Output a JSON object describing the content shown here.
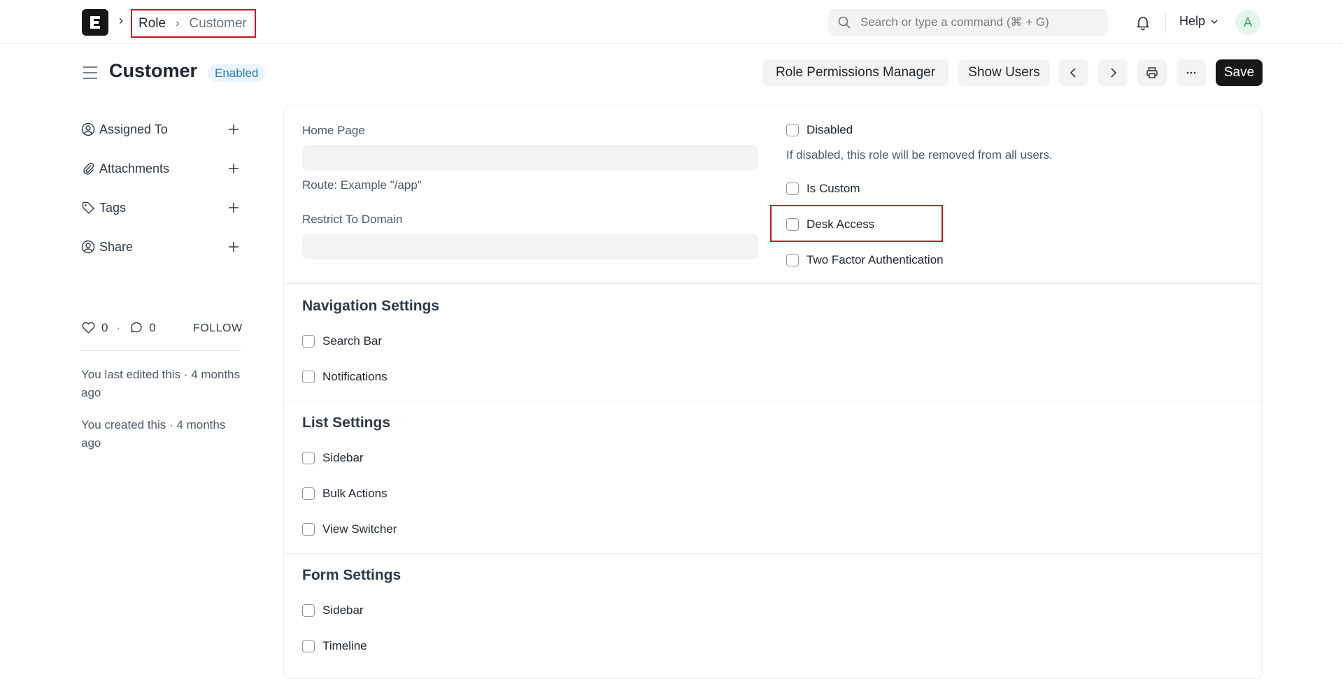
{
  "navbar": {
    "breadcrumb": [
      "Role",
      "Customer"
    ],
    "search_placeholder": "Search or type a command (⌘ + G)",
    "help_label": "Help",
    "avatar_initial": "A"
  },
  "page": {
    "title": "Customer",
    "status": "Enabled",
    "buttons": {
      "role_permissions": "Role Permissions Manager",
      "show_users": "Show Users",
      "save": "Save"
    }
  },
  "sidebar": {
    "items": [
      {
        "label": "Assigned To",
        "icon": "assign-icon"
      },
      {
        "label": "Attachments",
        "icon": "paperclip-icon"
      },
      {
        "label": "Tags",
        "icon": "tag-icon"
      },
      {
        "label": "Share",
        "icon": "share-icon"
      }
    ],
    "likes": "0",
    "comments": "0",
    "follow": "FOLLOW",
    "last_edited": "You last edited this · 4 months ago",
    "created": "You created this · 4 months ago"
  },
  "form": {
    "home_page_label": "Home Page",
    "home_page_value": "",
    "route_help": "Route: Example \"/app\"",
    "restrict_domain_label": "Restrict To Domain",
    "restrict_domain_value": "",
    "disabled_label": "Disabled",
    "disabled_help": "If disabled, this role will be removed from all users.",
    "is_custom_label": "Is Custom",
    "desk_access_label": "Desk Access",
    "two_factor_label": "Two Factor Authentication",
    "navigation": {
      "title": "Navigation Settings",
      "search_bar": "Search Bar",
      "notifications": "Notifications"
    },
    "list": {
      "title": "List Settings",
      "sidebar": "Sidebar",
      "bulk_actions": "Bulk Actions",
      "view_switcher": "View Switcher"
    },
    "form_settings": {
      "title": "Form Settings",
      "sidebar": "Sidebar",
      "timeline": "Timeline"
    }
  },
  "colors": {
    "accent_dark": "#171717",
    "highlight": "#c8102e",
    "badge_blue": "#2a7bbd"
  }
}
